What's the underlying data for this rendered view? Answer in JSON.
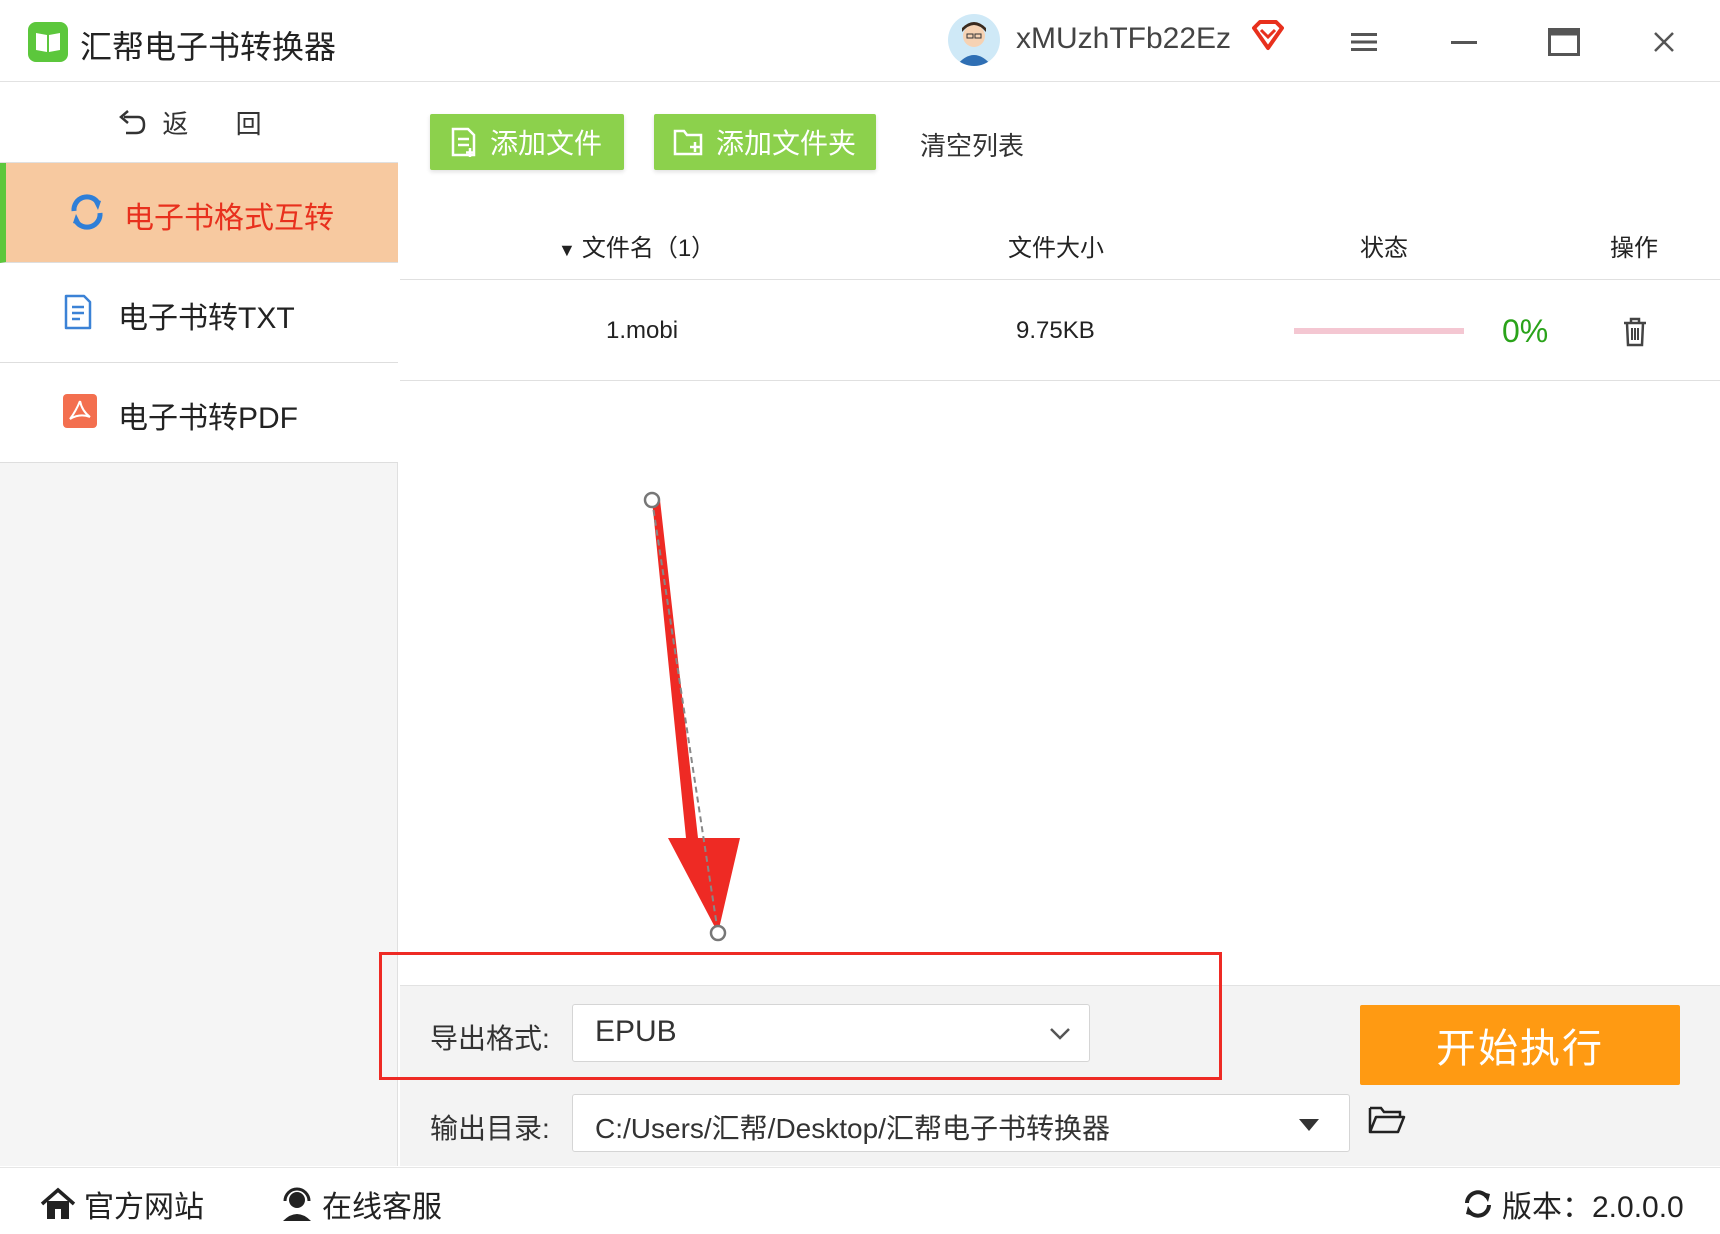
{
  "app": {
    "title": "汇帮电子书转换器",
    "username": "xMUzhTFb22Ez"
  },
  "sidebar": {
    "back_label": "返 回",
    "items": [
      {
        "label": "电子书格式互转",
        "active": true
      },
      {
        "label": "电子书转TXT",
        "active": false
      },
      {
        "label": "电子书转PDF",
        "active": false
      }
    ]
  },
  "toolbar": {
    "add_file": "添加文件",
    "add_folder": "添加文件夹",
    "clear_list": "清空列表"
  },
  "table": {
    "headers": {
      "filename": "文件名（1）",
      "size": "文件大小",
      "status": "状态",
      "action": "操作"
    },
    "rows": [
      {
        "filename": "1.mobi",
        "size": "9.75KB",
        "progress": "0%",
        "progress_value": 0
      }
    ]
  },
  "export": {
    "format_label": "导出格式:",
    "format_value": "EPUB",
    "dir_label": "输出目录:",
    "dir_value": "C:/Users/汇帮/Desktop/汇帮电子书转换器",
    "start_button": "开始执行"
  },
  "footer": {
    "website": "官方网站",
    "support": "在线客服",
    "version": "版本：2.0.0.0"
  },
  "colors": {
    "accent_green": "#8cd14c",
    "active_nav_bg": "#f7c9a0",
    "active_nav_text": "#e8301d",
    "start_button": "#ff9a12",
    "highlight_red": "#ee2a24",
    "progress_text": "#2aa31a"
  }
}
